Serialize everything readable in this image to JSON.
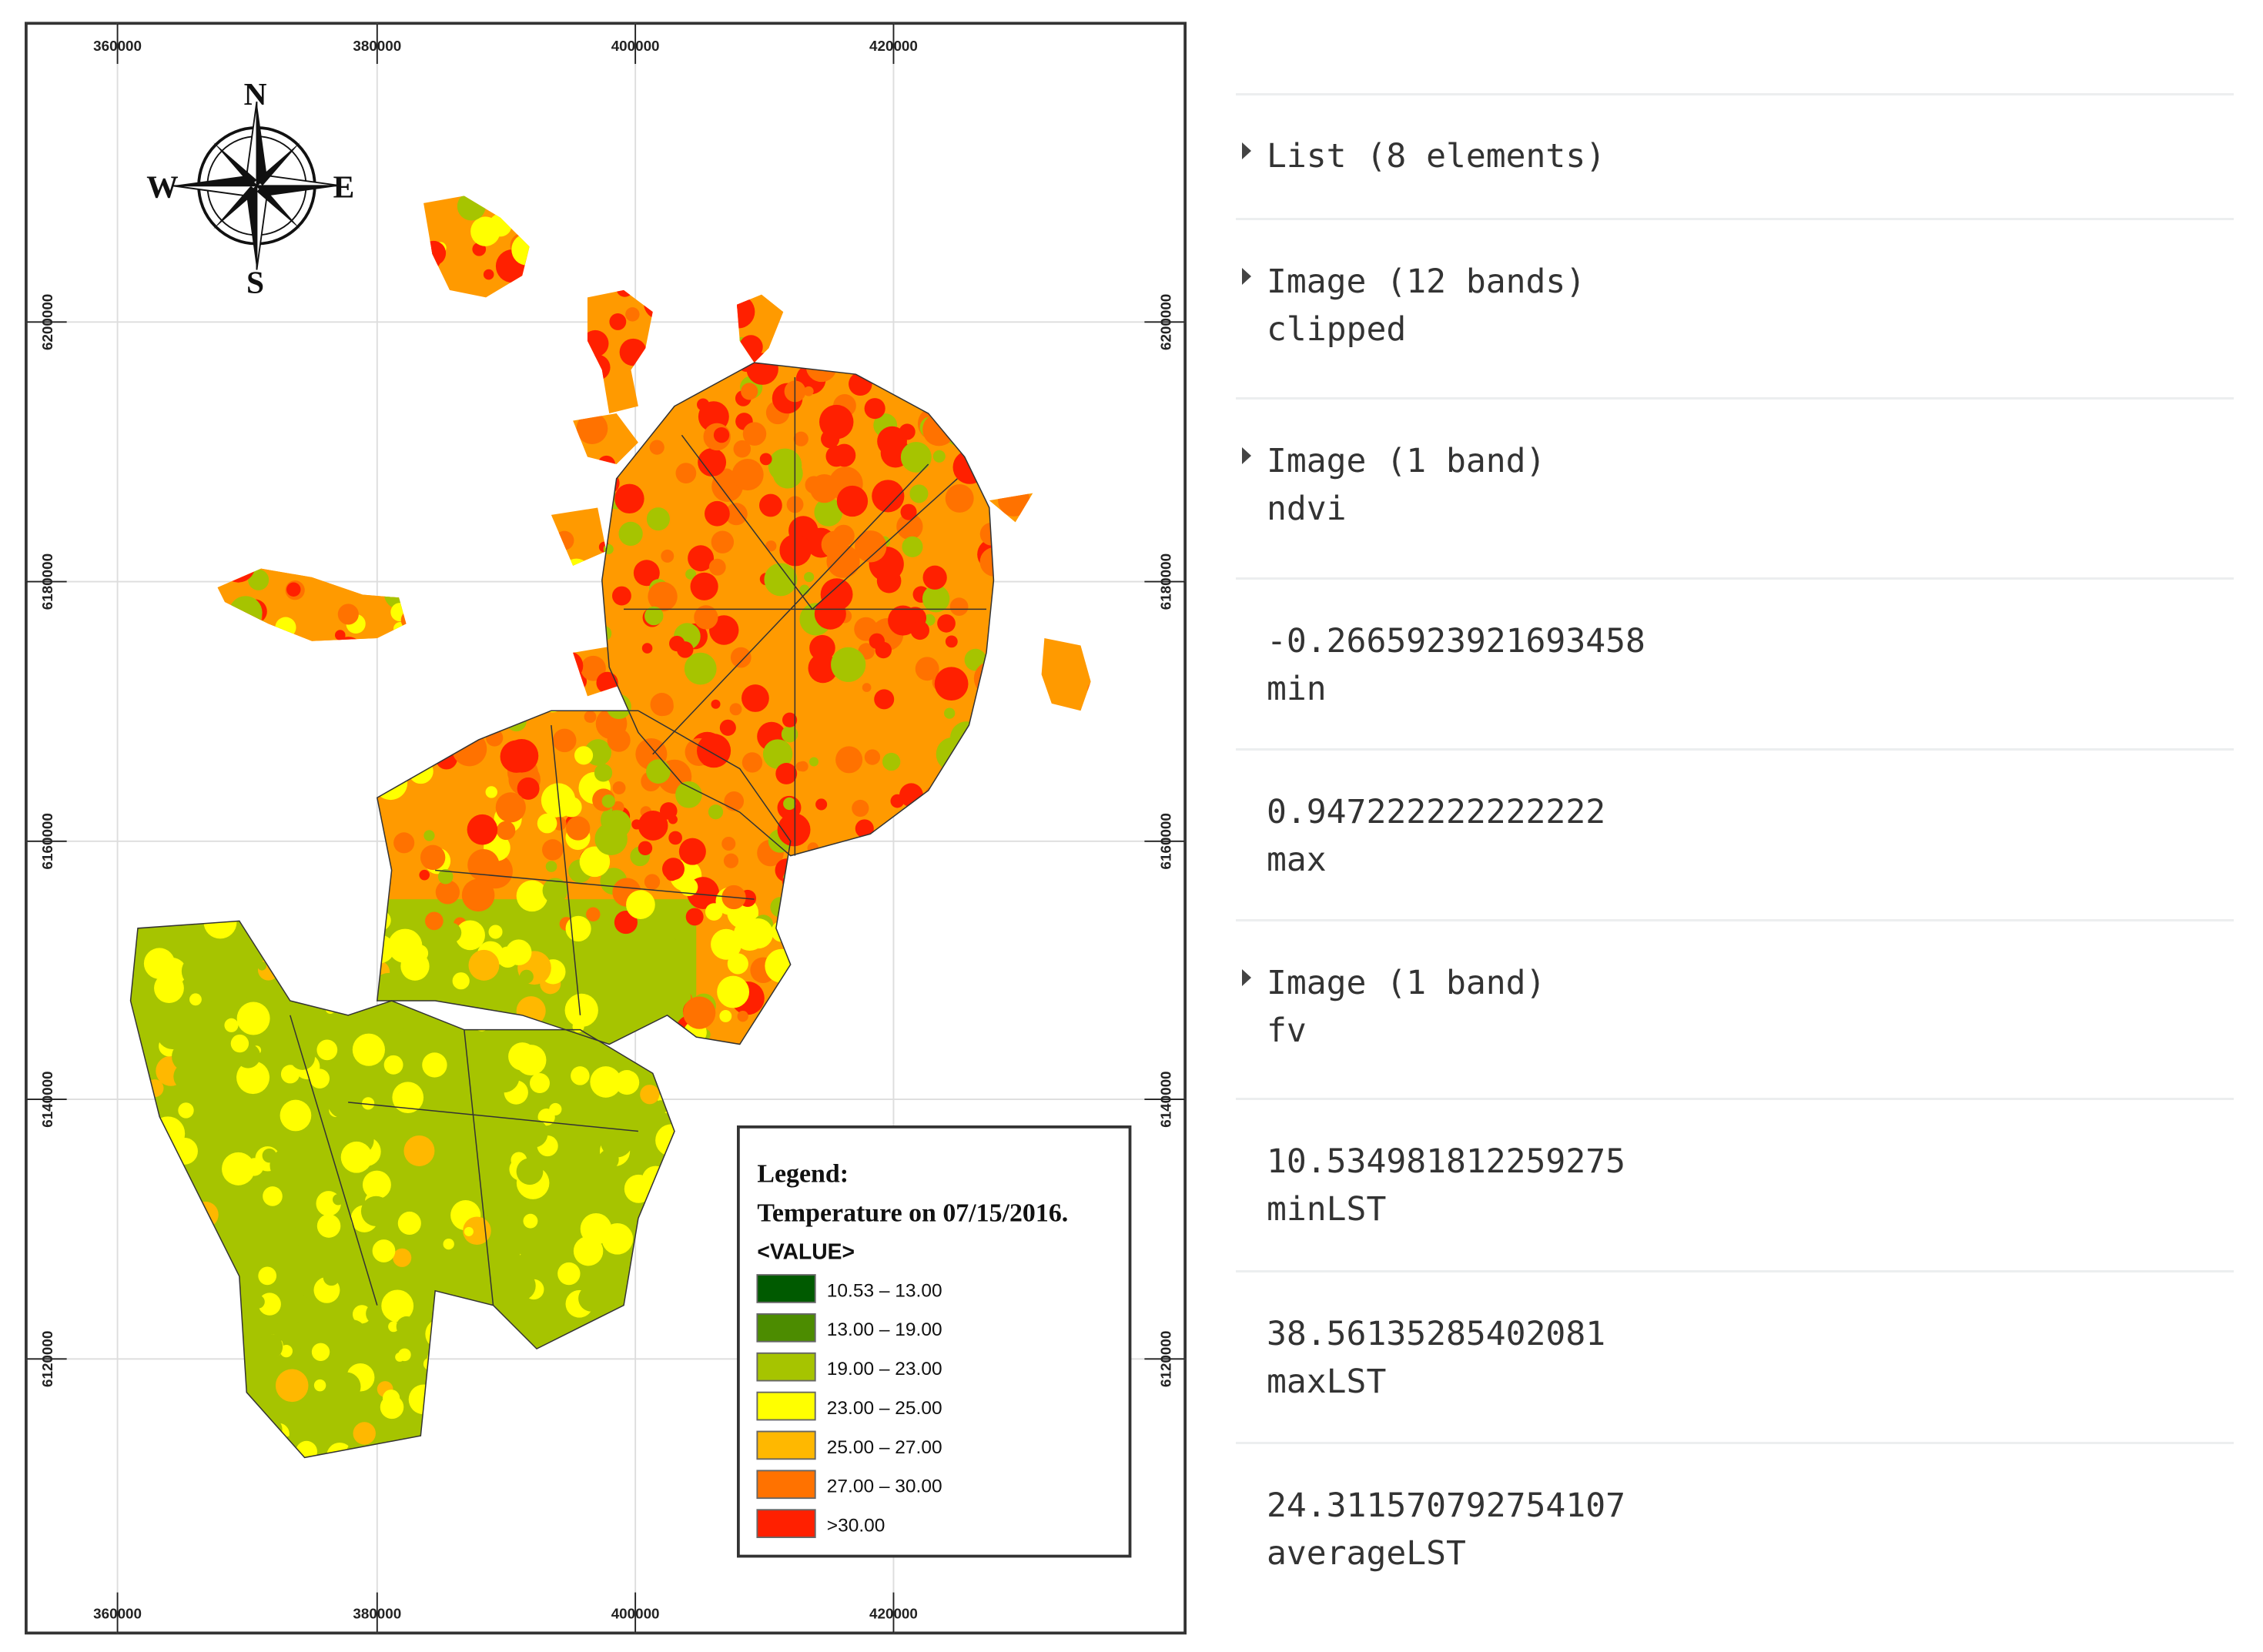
{
  "map": {
    "x_ticks": [
      "360000",
      "380000",
      "400000",
      "420000"
    ],
    "y_ticks": [
      "6200000",
      "6180000",
      "6160000",
      "6140000",
      "6120000"
    ],
    "compass": {
      "n": "N",
      "s": "S",
      "e": "E",
      "w": "W"
    },
    "legend": {
      "heading": "Legend:",
      "title": "Temperature on 07/15/2016.",
      "field": "<VALUE>",
      "classes": [
        {
          "label": "10.53 – 13.00",
          "color": "#005a00"
        },
        {
          "label": "13.00 – 19.00",
          "color": "#4c8c00"
        },
        {
          "label": "19.00 – 23.00",
          "color": "#a6c400"
        },
        {
          "label": "23.00 – 25.00",
          "color": "#ffff00"
        },
        {
          "label": "25.00 – 27.00",
          "color": "#ffb800"
        },
        {
          "label": "27.00 – 30.00",
          "color": "#ff7200"
        },
        {
          "label": ">30.00",
          "color": "#ff2000"
        }
      ]
    }
  },
  "console": {
    "entries": [
      {
        "title": "List (8 elements)",
        "expandable": true
      },
      {
        "title": "Image (12 bands)",
        "sub": "clipped",
        "expandable": true
      },
      {
        "title": "Image (1 band)",
        "sub": "ndvi",
        "expandable": true
      },
      {
        "title": "-0.2665923921693458",
        "sub": "min",
        "expandable": false
      },
      {
        "title": "0.947222222222222",
        "sub": "max",
        "expandable": false
      },
      {
        "title": "Image (1 band)",
        "sub": "fv",
        "expandable": true
      },
      {
        "title": "10.534981812259275",
        "sub": "minLST",
        "expandable": false
      },
      {
        "title": "38.56135285402081",
        "sub": "maxLST",
        "expandable": false
      },
      {
        "title": "24.311570792754107",
        "sub": "averageLST",
        "expandable": false
      }
    ]
  }
}
